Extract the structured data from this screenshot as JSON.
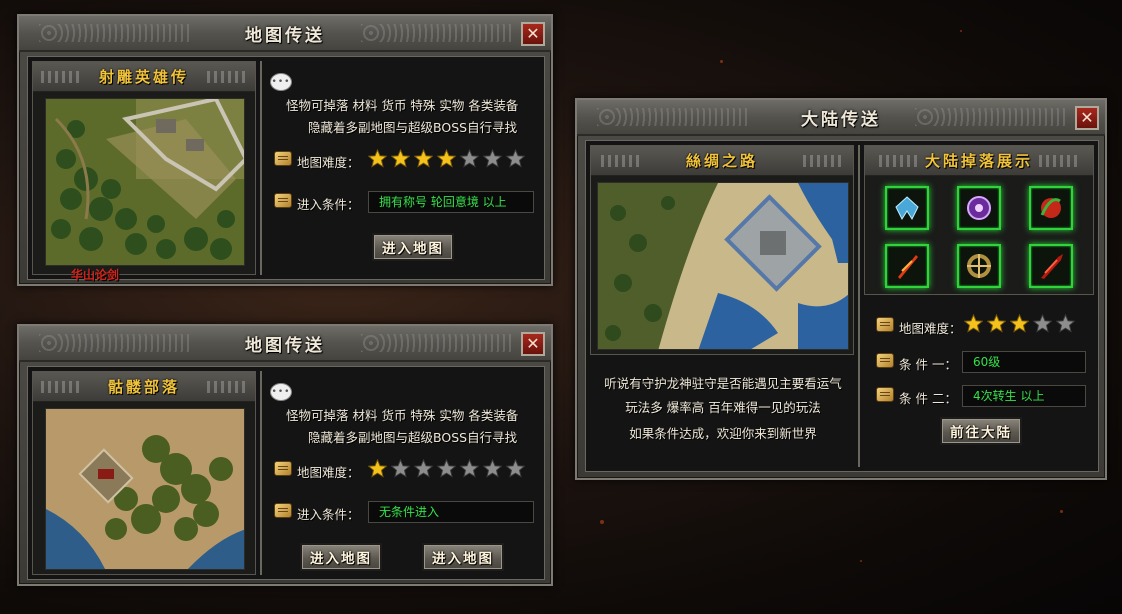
{
  "panel_top": {
    "title": "地图传送",
    "close_label": "✕",
    "map_name": "射雕英雄传",
    "map_image_label": "华山论剑",
    "info_line1": "怪物可掉落 材料 货币 特殊 实物 各类装备",
    "info_line2": "隐藏着多副地图与超级BOSS自行寻找",
    "difficulty_label": "地图难度：",
    "difficulty": 4,
    "difficulty_max": 7,
    "condition_label": "进入条件：",
    "condition_value": "拥有称号 轮回意境 以上",
    "enter_button": "进入地图"
  },
  "panel_bottom": {
    "title": "地图传送",
    "close_label": "✕",
    "map_name": "骷髅部落",
    "info_line1": "怪物可掉落 材料 货币 特殊 实物 各类装备",
    "info_line2": "隐藏着多副地图与超级BOSS自行寻找",
    "difficulty_label": "地图难度：",
    "difficulty": 1,
    "difficulty_max": 7,
    "condition_label": "进入条件：",
    "condition_value": "无条件进入",
    "enter_button_1": "进入地图",
    "enter_button_2": "进入地图"
  },
  "panel_continent": {
    "title": "大陆传送",
    "close_label": "✕",
    "map_name": "絲绸之路",
    "drops_title": "大陆掉落展示",
    "drop_items": [
      "wings-icon",
      "purple-emblem-icon",
      "red-orb-icon",
      "flame-sword-icon",
      "golden-ring-icon",
      "blood-blade-icon"
    ],
    "desc_line1": "听说有守护龙神驻守是否能遇见主要看运气",
    "desc_line2": "玩法多 爆率高 百年难得一见的玩法",
    "desc_line3": "如果条件达成，欢迎你来到新世界",
    "difficulty_label": "地图难度：",
    "difficulty": 3,
    "difficulty_max": 5,
    "condition1_label": "条 件 一：",
    "condition1_value": "60级",
    "condition2_label": "条 件 二：",
    "condition2_value": "4次转生 以上",
    "go_button": "前往大陆"
  },
  "colors": {
    "gold_title": "#f0c33a",
    "green_value": "#35e04a",
    "star_gold": "#f5c21b",
    "star_empty": "#8d8d8d"
  }
}
